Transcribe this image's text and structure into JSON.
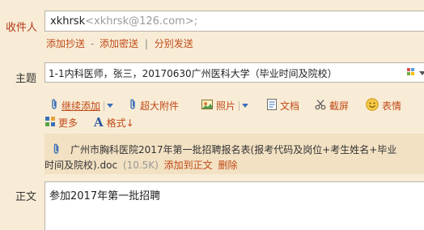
{
  "recipients": {
    "label": "收件人",
    "name": "xkhrsk",
    "address": "<xkhrsk@126.com>;"
  },
  "recipient_links": {
    "cc": "添加抄送",
    "dash": "-",
    "bcc": "添加密送",
    "bar": "|",
    "separate": "分别发送"
  },
  "subject": {
    "label": "主题",
    "value": "1-1内科医师，张三，20170630广州医科大学（毕业时间及院校）"
  },
  "toolbar": {
    "continue_add": "继续添加",
    "large_attachment": "超大附件",
    "photo": "照片",
    "document": "文档",
    "screenshot": "截屏",
    "emoji": "表情",
    "more": "更多",
    "format": "格式↓"
  },
  "attachment": {
    "filename_line1": "广州市胸科医院2017年第一批招聘报名表(报考代码及岗位+考生姓名+毕业",
    "filename_line2": "时间及院校).doc",
    "size": "(10.5K)",
    "add_to_body": "添加到正文",
    "delete": "删除"
  },
  "body": {
    "label": "正文",
    "text": "参加2017年第一批招聘"
  },
  "colors": {
    "panel_bg": "#f8ecd6",
    "link": "#c04a17",
    "label_red": "#b23a1a"
  }
}
